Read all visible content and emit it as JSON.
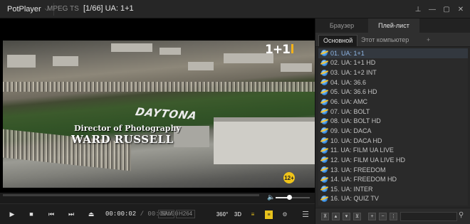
{
  "titlebar": {
    "app_name": "PotPlayer",
    "format": "MPEG TS",
    "title": "[1/66] UA: 1+1",
    "controls": {
      "pin": "⊥",
      "minimize": "—",
      "restore": "▢",
      "close": "✕"
    }
  },
  "video": {
    "channel_logo": "1+1",
    "credit_line1": "Director of Photography",
    "credit_line2": "WARD RUSSELL",
    "scene_text": "DAYTONA",
    "age_badge": "12+"
  },
  "playback": {
    "current_time": "00:00:02",
    "duration": "/ 00:00:00",
    "sw_tag": "S/W",
    "codec_tag": "H264",
    "progress": 0.0,
    "volume": 0.4
  },
  "controls": {
    "play": "▶",
    "stop": "■",
    "prev": "⏮",
    "next": "⏭",
    "eject": "⏏",
    "vr360": "360°",
    "threed": "3D",
    "menu": "☰"
  },
  "panel": {
    "tabs": [
      {
        "label": "Браузер",
        "active": false
      },
      {
        "label": "Плей-лист",
        "active": true
      }
    ],
    "subtabs": [
      {
        "label": "Основной",
        "active": true
      },
      {
        "label": "Этот компьютер",
        "active": false
      },
      {
        "label": "+",
        "active": false
      }
    ],
    "playlist": [
      "01. UA: 1+1",
      "02. UA: 1+1 HD",
      "03. UA: 1+2 INT",
      "04. UA: 36.6",
      "05. UA: 36.6 HD",
      "06. UA: AMC",
      "07. UA: BOLT",
      "08. UA: BOLT HD",
      "09. UA: DACA",
      "10. UA: DACA HD",
      "11. UA: FILM UA LIVE",
      "12. UA: FILM UA LIVE HD",
      "13. UA: FREEDOM",
      "14. UA: FREEDOM HD",
      "15. UA: INTER",
      "16. UA: QUIZ TV"
    ],
    "selected_index": 0
  },
  "colors": {
    "accent": "#e8c21c",
    "selected": "#8fb6e6"
  }
}
